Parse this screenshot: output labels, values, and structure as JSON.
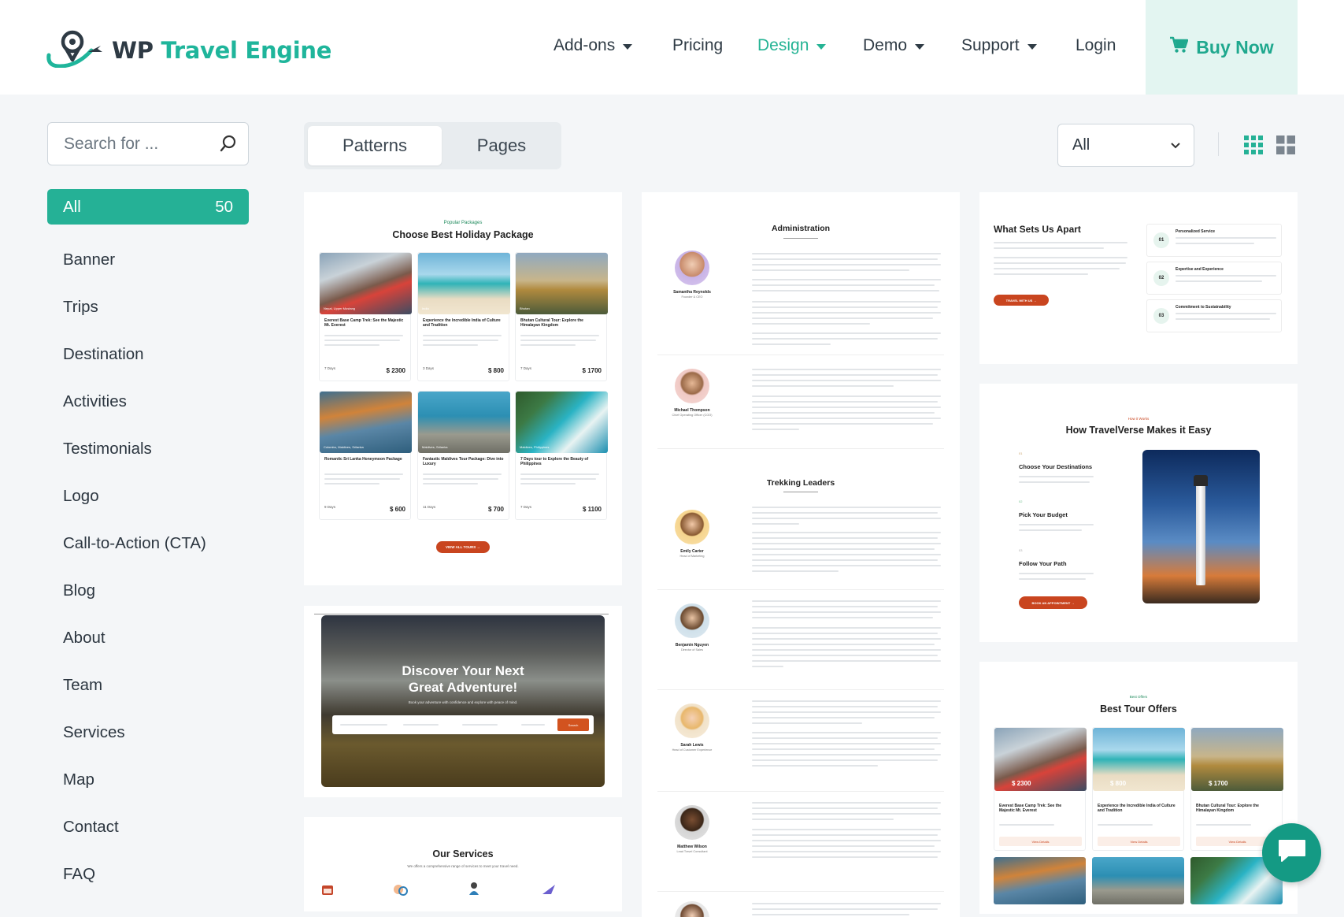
{
  "brand": {
    "word1": "WP",
    "word2": "Travel Engine",
    "accent": "#1fb59b"
  },
  "nav": {
    "items": [
      {
        "label": "Add-ons",
        "dropdown": true
      },
      {
        "label": "Pricing",
        "dropdown": false
      },
      {
        "label": "Design",
        "dropdown": true,
        "active": true
      },
      {
        "label": "Demo",
        "dropdown": true
      },
      {
        "label": "Support",
        "dropdown": true
      },
      {
        "label": "Login",
        "dropdown": false
      }
    ],
    "buy_label": "Buy Now"
  },
  "search": {
    "placeholder": "Search for ..."
  },
  "categories": {
    "all_label": "All",
    "all_count": "50",
    "items": [
      "Banner",
      "Trips",
      "Destination",
      "Activities",
      "Testimonials",
      "Logo",
      "Call-to-Action (CTA)",
      "Blog",
      "About",
      "Team",
      "Services",
      "Map",
      "Contact",
      "FAQ"
    ]
  },
  "tabs": {
    "patterns": "Patterns",
    "pages": "Pages"
  },
  "filter": {
    "selected": "All"
  },
  "cards": {
    "holiday": {
      "eyebrow": "Popular Packages",
      "title": "Choose Best Holiday Package",
      "cta": "VIEW ALL TOURS →",
      "trips": [
        {
          "loc": "Nepal, Upper Mustang",
          "name": "Everest Base Camp Trek: See the Majestic Mt. Everest",
          "price": "$ 2300",
          "days": "7 Days"
        },
        {
          "loc": "India",
          "name": "Experience the Incredible India of Culture and Tradition",
          "price": "$ 800",
          "days": "3 Days"
        },
        {
          "loc": "Bhutan",
          "name": "Bhutan Cultural Tour: Explore the Himalayan Kingdom",
          "price": "$ 1700",
          "days": "7 Days"
        },
        {
          "loc": "Colombo, Maldives, Srilanka",
          "name": "Romantic Sri Lanka Honeymoon Package",
          "price": "$ 600",
          "days": "9 Days"
        },
        {
          "loc": "Maldives, Srilanka",
          "name": "Fantastic Maldives Tour Package: Dive into Luxury",
          "price": "$ 700",
          "days": "11 Days"
        },
        {
          "loc": "Maldives, Philippines",
          "name": "7 Days tour to Explore the Beauty of Philippines",
          "price": "$ 1100",
          "days": "7 Days"
        }
      ]
    },
    "banner": {
      "title": "Discover Your Next Great Adventure!",
      "sub": "Book your adventure with confidence and explore with peace of mind.",
      "search_btn": "Search"
    },
    "services": {
      "title": "Our Services",
      "sub": "We offers a comprehensive range of services to meet your travel need."
    },
    "team": {
      "admin_heading": "Administration",
      "leaders_heading": "Trekking Leaders",
      "members": [
        {
          "name": "Samantha Reynolds",
          "role": "Founder & CEO"
        },
        {
          "name": "Michael Thompson",
          "role": "Chief Operating Officer (COO)"
        },
        {
          "name": "Emily Carter",
          "role": "Head of Marketing"
        },
        {
          "name": "Benjamin Nguyen",
          "role": "Director of Sales"
        },
        {
          "name": "Sarah Lewis",
          "role": "Head of Customer Experience"
        },
        {
          "name": "Matthew Wilson",
          "role": "Lead Travel Consultant"
        }
      ]
    },
    "apart": {
      "title": "What Sets Us Apart",
      "cta": "TRAVEL WITH US →",
      "points": [
        {
          "num": "01",
          "title": "Personalized Service"
        },
        {
          "num": "02",
          "title": "Expertise and Experience"
        },
        {
          "num": "03",
          "title": "Commitment to Sustainability"
        }
      ]
    },
    "howto": {
      "eyebrow": "How it Works",
      "title": "How TravelVerse Makes it Easy",
      "cta": "BOOK AN APPOINTMENT →",
      "steps": [
        {
          "num": "01",
          "title": "Choose Your Destinations"
        },
        {
          "num": "02",
          "title": "Pick Your Budget"
        },
        {
          "num": "03",
          "title": "Follow Your Path"
        }
      ]
    },
    "offers": {
      "eyebrow": "Best Offers",
      "title": "Best Tour Offers",
      "trips": [
        {
          "price": "$ 2300",
          "name": "Everest Base Camp Trek: See the Majestic Mt. Everest",
          "btn": "View Details"
        },
        {
          "price": "$ 800",
          "name": "Experience the Incredible India of Culture and Tradition",
          "btn": "View Details"
        },
        {
          "price": "$ 1700",
          "name": "Bhutan Cultural Tour: Explore the Himalayan Kingdom",
          "btn": "View Details"
        }
      ]
    }
  },
  "icons": {
    "logo": "pin-plane-logo-icon",
    "cart": "cart-icon",
    "search": "search-icon",
    "chevron": "chevron-down-icon",
    "grid_small": "grid-3x3-icon",
    "grid_large": "grid-2x2-icon",
    "chat": "chat-icon"
  }
}
